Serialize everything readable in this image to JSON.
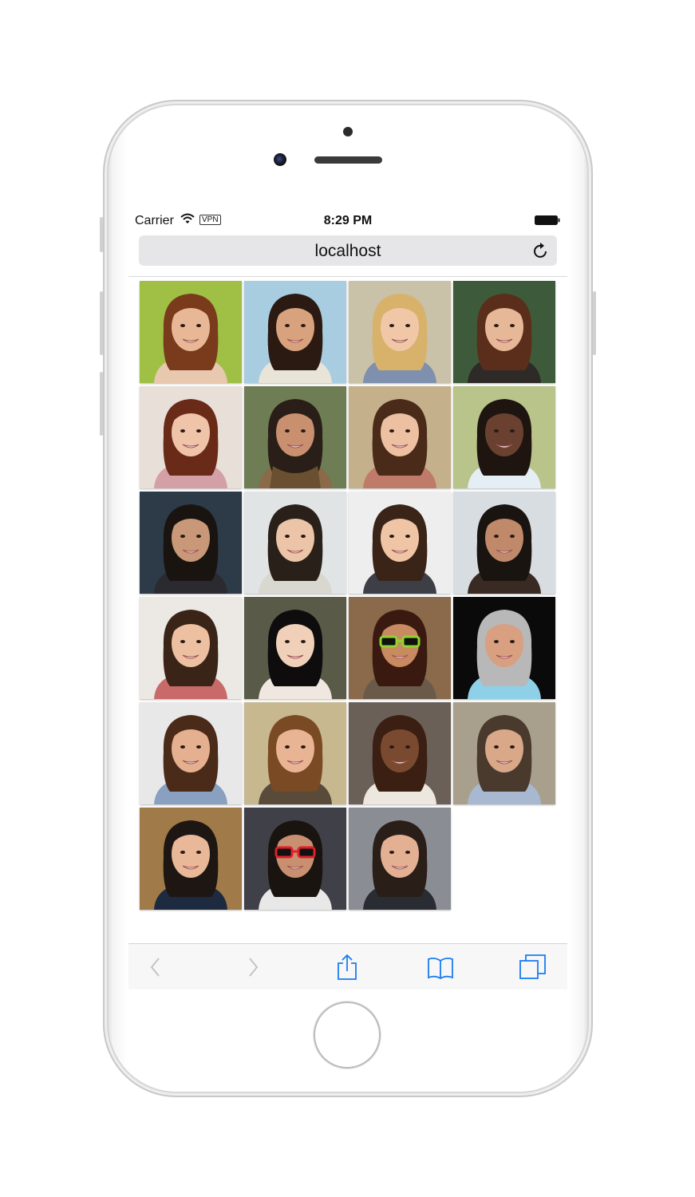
{
  "status_bar": {
    "carrier": "Carrier",
    "vpn": "VPN",
    "time": "8:29 PM"
  },
  "address_bar": {
    "url": "localhost"
  },
  "photos": [
    {
      "bg": "#9fbf45",
      "hair": "#7a3a1c",
      "skin": "#e8b896",
      "shirt": "#e9c8b0",
      "accessory": ""
    },
    {
      "bg": "#a9cde0",
      "hair": "#2a1a12",
      "skin": "#d9a27e",
      "shirt": "#e8e4d8",
      "accessory": ""
    },
    {
      "bg": "#c9c1a8",
      "hair": "#d8b26a",
      "skin": "#f0c8a8",
      "shirt": "#7f8fae",
      "accessory": ""
    },
    {
      "bg": "#3d5a3a",
      "hair": "#5a2e1a",
      "skin": "#e6b898",
      "shirt": "#2d2a28",
      "accessory": ""
    },
    {
      "bg": "#e8e0d8",
      "hair": "#6a2a18",
      "skin": "#f0c4a8",
      "shirt": "#d4a0a8",
      "accessory": ""
    },
    {
      "bg": "#6f7d55",
      "hair": "#2a1f18",
      "skin": "#c99070",
      "shirt": "#8a6a48",
      "accessory": "scarf"
    },
    {
      "bg": "#c4b08a",
      "hair": "#4a2a18",
      "skin": "#ecc0a0",
      "shirt": "#c07a6a",
      "accessory": ""
    },
    {
      "bg": "#b8c48a",
      "hair": "#1e1410",
      "skin": "#6a4030",
      "shirt": "#e4eef4",
      "accessory": ""
    },
    {
      "bg": "#2d3a48",
      "hair": "#1a1410",
      "skin": "#c89878",
      "shirt": "#2a2a30",
      "accessory": ""
    },
    {
      "bg": "#e0e4e4",
      "hair": "#2a201a",
      "skin": "#ecc4a8",
      "shirt": "#d8d8d0",
      "accessory": ""
    },
    {
      "bg": "#eeeeee",
      "hair": "#3a2418",
      "skin": "#efc5a6",
      "shirt": "#3e3e46",
      "accessory": ""
    },
    {
      "bg": "#d8dde2",
      "hair": "#1a1410",
      "skin": "#c08a6a",
      "shirt": "#3a2a24",
      "accessory": ""
    },
    {
      "bg": "#ece8e4",
      "hair": "#3a2418",
      "skin": "#ecc0a0",
      "shirt": "#c86a6a",
      "accessory": ""
    },
    {
      "bg": "#5a5a48",
      "hair": "#0e0c0c",
      "skin": "#f0d0b8",
      "shirt": "#f0e8e0",
      "accessory": ""
    },
    {
      "bg": "#8a6a4a",
      "hair": "#3a1a10",
      "skin": "#c88a60",
      "shirt": "#6a5a4a",
      "accessory": "green-sunglasses"
    },
    {
      "bg": "#0a0a0a",
      "hair": "#b8b8b8",
      "skin": "#d8a080",
      "shirt": "#8ed0e8",
      "accessory": ""
    },
    {
      "bg": "#e8e8e8",
      "hair": "#4a2a18",
      "skin": "#e4b090",
      "shirt": "#8aa0c0",
      "accessory": ""
    },
    {
      "bg": "#c8b890",
      "hair": "#7a4a24",
      "skin": "#e8b494",
      "shirt": "#5a4a3a",
      "accessory": ""
    },
    {
      "bg": "#6a6058",
      "hair": "#3a1f12",
      "skin": "#7a4a30",
      "shirt": "#ece8e0",
      "accessory": ""
    },
    {
      "bg": "#a8a08c",
      "hair": "#4a3a2e",
      "skin": "#d8a888",
      "shirt": "#a8b8d0",
      "accessory": ""
    },
    {
      "bg": "#a07a48",
      "hair": "#1e1612",
      "skin": "#e8b898",
      "shirt": "#1e2a40",
      "accessory": ""
    },
    {
      "bg": "#404048",
      "hair": "#1a1410",
      "skin": "#c89070",
      "shirt": "#e8e8e8",
      "accessory": "red-sunglasses"
    },
    {
      "bg": "#8a8e94",
      "hair": "#2a1e18",
      "skin": "#e4b094",
      "shirt": "#2a2c34",
      "accessory": ""
    }
  ]
}
